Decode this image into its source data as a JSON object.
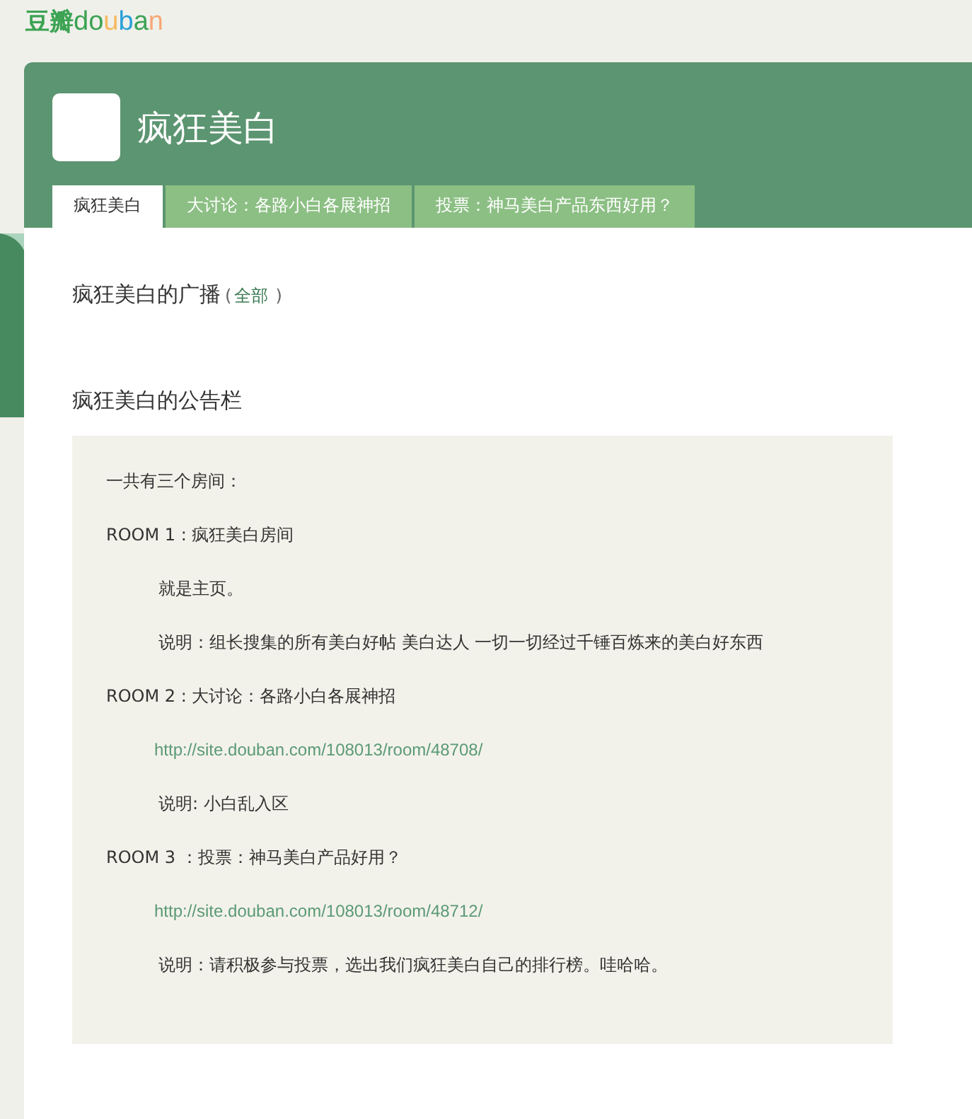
{
  "logo": {
    "cn": "豆瓣",
    "en": "douban"
  },
  "group": {
    "name": "疯狂美白"
  },
  "tabs": [
    {
      "label": "疯狂美白",
      "selected": true
    },
    {
      "label": "大讨论：各路小白各展神招",
      "selected": false
    },
    {
      "label": "投票：神马美白产品东西好用？",
      "selected": false
    }
  ],
  "broadcast": {
    "title": "疯狂美白的广播",
    "open": "(",
    "link": "全部",
    "close": ")"
  },
  "board": {
    "title": "疯狂美白的公告栏",
    "lines": [
      {
        "kind": "plain",
        "text": "一共有三个房间："
      },
      {
        "kind": "plain",
        "text": "ROOM 1 : 疯狂美白房间"
      },
      {
        "kind": "indent",
        "text": "就是主页。"
      },
      {
        "kind": "indent",
        "text": "说明：组长搜集的所有美白好帖 美白达人 一切一切经过千锤百炼来的美白好东西"
      },
      {
        "kind": "plain",
        "text": "ROOM 2 : 大讨论：各路小白各展神招"
      },
      {
        "kind": "link",
        "text": "http://site.douban.com/108013/room/48708/"
      },
      {
        "kind": "indent",
        "text": "说明: 小白乱入区"
      },
      {
        "kind": "plain",
        "text": "ROOM 3 ：投票：神马美白产品好用？"
      },
      {
        "kind": "link",
        "text": "http://site.douban.com/108013/room/48712/"
      },
      {
        "kind": "indent",
        "text": "说明：请积极参与投票，选出我们疯狂美白自己的排行榜。哇哈哈。"
      }
    ]
  }
}
